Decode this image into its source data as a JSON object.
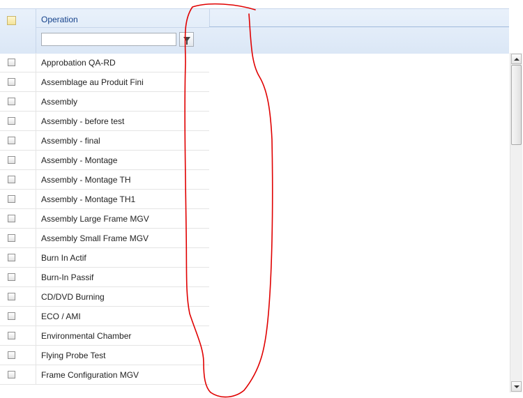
{
  "grid": {
    "header": {
      "column_title": "Operation"
    },
    "filter": {
      "value": "",
      "placeholder": ""
    },
    "rows": [
      "Approbation QA-RD",
      "Assemblage au Produit Fini",
      "Assembly",
      "Assembly - before test",
      "Assembly - final",
      "Assembly - Montage",
      "Assembly - Montage TH",
      "Assembly - Montage TH1",
      "Assembly Large Frame MGV",
      "Assembly Small Frame MGV",
      "Burn In Actif",
      "Burn-In Passif",
      "CD/DVD Burning",
      "ECO / AMI",
      "Environmental Chamber",
      "Flying Probe Test",
      "Frame Configuration MGV"
    ]
  },
  "colors": {
    "header_bg": "#dbe7f6",
    "header_text": "#15428b",
    "annotation": "#e00000"
  },
  "icons": {
    "filter_button": "funnel-icon",
    "scroll_up": "arrow-up-icon",
    "scroll_down": "arrow-down-icon"
  }
}
